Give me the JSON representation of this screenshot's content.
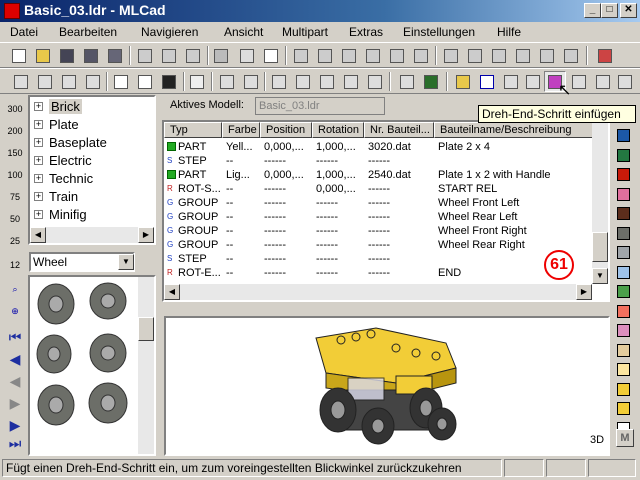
{
  "window": {
    "title": "Basic_03.ldr - MLCad",
    "min": "_",
    "max": "□",
    "close": "✕"
  },
  "menu": [
    "Datei",
    "Bearbeiten",
    "Navigieren",
    "Ansicht",
    "Multipart",
    "Extras",
    "Einstellungen",
    "Hilfe"
  ],
  "tree": [
    "Brick",
    "Plate",
    "Baseplate",
    "Electric",
    "Technic",
    "Train",
    "Minifig"
  ],
  "parts_filter": "Wheel",
  "model": {
    "label": "Aktives Modell:",
    "value": "Basic_03.ldr"
  },
  "tooltip": "Dreh-End-Schritt einfügen",
  "table": {
    "headers": [
      "Typ",
      "Farbe",
      "Position",
      "Rotation",
      "Nr. Bauteil...",
      "Bauteilname/Beschreibung"
    ],
    "rows": [
      [
        "PART",
        "Yell...",
        "0,000,...",
        "1,000,...",
        "3020.dat",
        "Plate  2 x  4"
      ],
      [
        "STEP",
        "--",
        "------",
        "------",
        "------",
        ""
      ],
      [
        "PART",
        "Lig...",
        "0,000,...",
        "1,000,...",
        "2540.dat",
        "Plate  1 x  2 with Handle"
      ],
      [
        "ROT-S...",
        "--",
        "------",
        "0,000,...",
        "------",
        "START REL"
      ],
      [
        "GROUP",
        "--",
        "------",
        "------",
        "------",
        "Wheel Front Left"
      ],
      [
        "GROUP",
        "--",
        "------",
        "------",
        "------",
        "Wheel Rear Left"
      ],
      [
        "GROUP",
        "--",
        "------",
        "------",
        "------",
        "Wheel Front Right"
      ],
      [
        "GROUP",
        "--",
        "------",
        "------",
        "------",
        "Wheel Rear Right"
      ],
      [
        "STEP",
        "--",
        "------",
        "------",
        "------",
        ""
      ],
      [
        "ROT-E...",
        "--",
        "------",
        "------",
        "------",
        "END"
      ]
    ]
  },
  "badge": "61",
  "view_label": "3D",
  "side_labels": [
    "300",
    "200",
    "150",
    "100",
    "75",
    "50",
    "25",
    "12"
  ],
  "swatch_letter": "M",
  "status": "Fügt einen Dreh-End-Schritt ein, um zum voreingestellten Blickwinkel zurückzukehren",
  "colors": {
    "palette": [
      "#ffffff",
      "#1c58a7",
      "#237841",
      "#c91a09",
      "#e06f9d",
      "#5c2e1c",
      "#6c6e68",
      "#a0a5a9",
      "#9fc3e9",
      "#4b9f4a",
      "#f2705e",
      "#dc8fbe",
      "#e4cd9e",
      "#fce6a0",
      "#f2cd37",
      "#f2cd37",
      "#ffffff",
      "#888888"
    ]
  }
}
